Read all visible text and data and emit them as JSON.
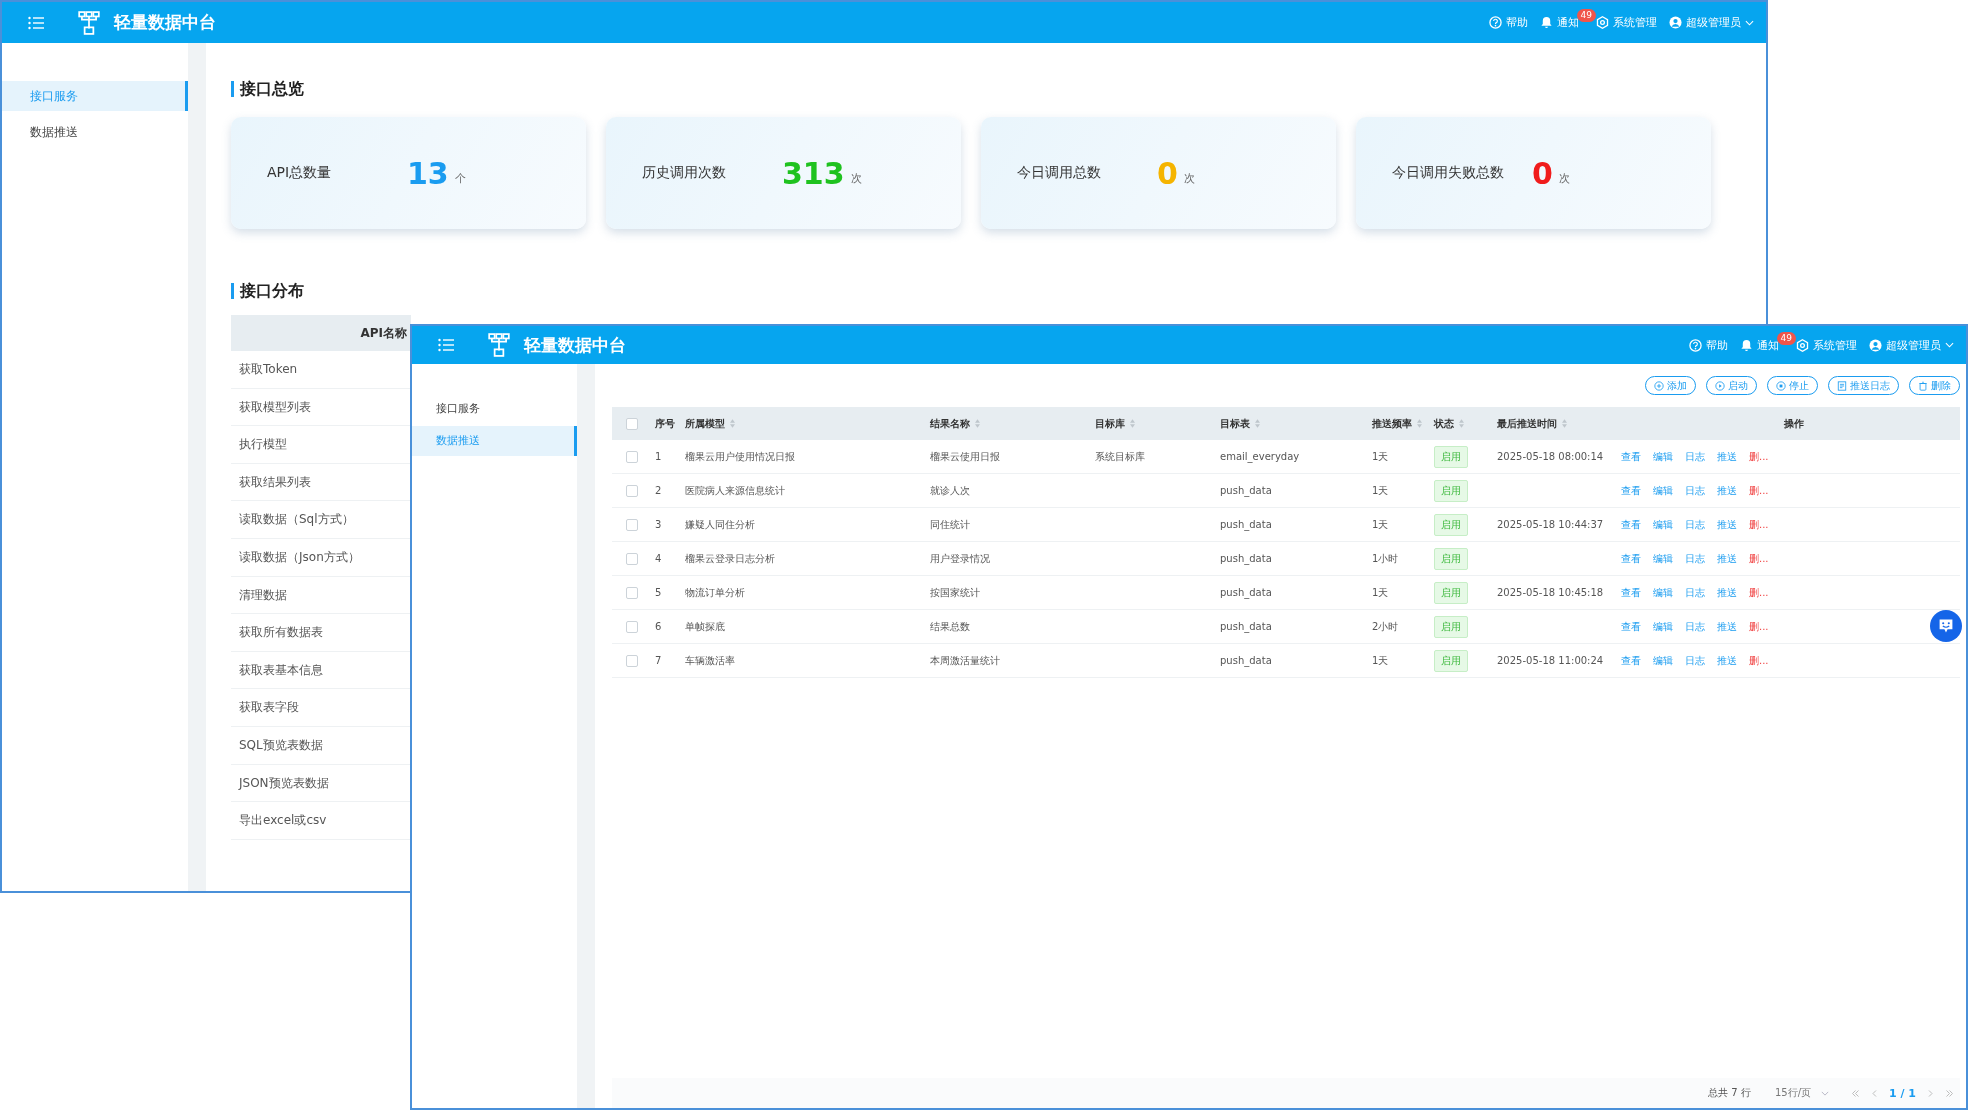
{
  "back_window": {
    "app_title": "轻量数据中台",
    "header_links": [
      {
        "kind": "help",
        "label": "帮助"
      },
      {
        "kind": "notice",
        "label": "通知",
        "badge": "49"
      },
      {
        "kind": "settings",
        "label": "系统管理"
      },
      {
        "kind": "user",
        "label": "超级管理员"
      }
    ],
    "nav": [
      {
        "label": "接口服务",
        "selected": true
      },
      {
        "label": "数据推送",
        "selected": false
      }
    ],
    "overview_title": "接口总览",
    "stats": [
      {
        "label": "API总数量",
        "value": "13",
        "unit": "个",
        "color": "#1a9cf0"
      },
      {
        "label": "历史调用次数",
        "value": "313",
        "unit": "次",
        "color": "#1fc21f"
      },
      {
        "label": "今日调用总数",
        "value": "0",
        "unit": "次",
        "color": "#f5b400"
      },
      {
        "label": "今日调用失败总数",
        "value": "0",
        "unit": "次",
        "color": "#f01c1c"
      }
    ],
    "distribution_title": "接口分布",
    "api_table": {
      "column": "API名称",
      "rows": [
        "获取Token",
        "获取模型列表",
        "执行模型",
        "获取结果列表",
        "读取数据（Sql方式）",
        "读取数据（Json方式）",
        "清理数据",
        "获取所有数据表",
        "获取表基本信息",
        "获取表字段",
        "SQL预览表数据",
        "JSON预览表数据",
        "导出excel或csv"
      ]
    }
  },
  "front_window": {
    "app_title": "轻量数据中台",
    "header_links": [
      {
        "kind": "help",
        "label": "帮助"
      },
      {
        "kind": "notice",
        "label": "通知",
        "badge": "49"
      },
      {
        "kind": "settings",
        "label": "系统管理"
      },
      {
        "kind": "user",
        "label": "超级管理员"
      }
    ],
    "nav": [
      {
        "label": "接口服务",
        "selected": false
      },
      {
        "label": "数据推送",
        "selected": true
      }
    ],
    "toolbar": [
      {
        "kind": "add",
        "label": "添加"
      },
      {
        "kind": "start",
        "label": "启动"
      },
      {
        "kind": "stop",
        "label": "停止"
      },
      {
        "kind": "log",
        "label": "推送日志"
      },
      {
        "kind": "delete",
        "label": "删除"
      }
    ],
    "all_checked": false,
    "columns": [
      {
        "label": "序号",
        "sortable": false
      },
      {
        "label": "所属模型",
        "sortable": true
      },
      {
        "label": "结果名称",
        "sortable": true
      },
      {
        "label": "目标库",
        "sortable": true
      },
      {
        "label": "目标表",
        "sortable": true
      },
      {
        "label": "推送频率",
        "sortable": true
      },
      {
        "label": "状态",
        "sortable": true
      },
      {
        "label": "最后推送时间",
        "sortable": true
      },
      {
        "label": "操作",
        "sortable": false
      }
    ],
    "rows": [
      {
        "checked": false,
        "no": "1",
        "model": "榴果云用户使用情况日报",
        "result": "榴果云使用日报",
        "db": "系统目标库",
        "table": "email_everyday",
        "freq": "1天",
        "status": "启用",
        "time": "2025-05-18 08:00:14",
        "actions": [
          {
            "kind": "normal",
            "label": "查看"
          },
          {
            "kind": "normal",
            "label": "编辑"
          },
          {
            "kind": "normal",
            "label": "日志"
          },
          {
            "kind": "normal",
            "label": "推送"
          },
          {
            "kind": "danger",
            "label": "删..."
          }
        ]
      },
      {
        "checked": false,
        "no": "2",
        "model": "医院病人来源信息统计",
        "result": "就诊人次",
        "db": "",
        "table": "push_data",
        "freq": "1天",
        "status": "启用",
        "time": "",
        "actions": [
          {
            "kind": "normal",
            "label": "查看"
          },
          {
            "kind": "normal",
            "label": "编辑"
          },
          {
            "kind": "normal",
            "label": "日志"
          },
          {
            "kind": "normal",
            "label": "推送"
          },
          {
            "kind": "danger",
            "label": "删..."
          }
        ]
      },
      {
        "checked": false,
        "no": "3",
        "model": "嫌疑人同住分析",
        "result": "同住统计",
        "db": "",
        "table": "push_data",
        "freq": "1天",
        "status": "启用",
        "time": "2025-05-18 10:44:37",
        "actions": [
          {
            "kind": "normal",
            "label": "查看"
          },
          {
            "kind": "normal",
            "label": "编辑"
          },
          {
            "kind": "normal",
            "label": "日志"
          },
          {
            "kind": "normal",
            "label": "推送"
          },
          {
            "kind": "danger",
            "label": "删..."
          }
        ]
      },
      {
        "checked": false,
        "no": "4",
        "model": "榴果云登录日志分析",
        "result": "用户登录情况",
        "db": "",
        "table": "push_data",
        "freq": "1小时",
        "status": "启用",
        "time": "",
        "actions": [
          {
            "kind": "normal",
            "label": "查看"
          },
          {
            "kind": "normal",
            "label": "编辑"
          },
          {
            "kind": "normal",
            "label": "日志"
          },
          {
            "kind": "normal",
            "label": "推送"
          },
          {
            "kind": "danger",
            "label": "删..."
          }
        ]
      },
      {
        "checked": false,
        "no": "5",
        "model": "物流订单分析",
        "result": "按国家统计",
        "db": "",
        "table": "push_data",
        "freq": "1天",
        "status": "启用",
        "time": "2025-05-18 10:45:18",
        "actions": [
          {
            "kind": "normal",
            "label": "查看"
          },
          {
            "kind": "normal",
            "label": "编辑"
          },
          {
            "kind": "normal",
            "label": "日志"
          },
          {
            "kind": "normal",
            "label": "推送"
          },
          {
            "kind": "danger",
            "label": "删..."
          }
        ]
      },
      {
        "checked": false,
        "no": "6",
        "model": "单帧探底",
        "result": "结果总数",
        "db": "",
        "table": "push_data",
        "freq": "2小时",
        "status": "启用",
        "time": "",
        "actions": [
          {
            "kind": "normal",
            "label": "查看"
          },
          {
            "kind": "normal",
            "label": "编辑"
          },
          {
            "kind": "normal",
            "label": "日志"
          },
          {
            "kind": "normal",
            "label": "推送"
          },
          {
            "kind": "danger",
            "label": "删..."
          }
        ]
      },
      {
        "checked": false,
        "no": "7",
        "model": "车辆激活率",
        "result": "本周激活量统计",
        "db": "",
        "table": "push_data",
        "freq": "1天",
        "status": "启用",
        "time": "2025-05-18 11:00:24",
        "actions": [
          {
            "kind": "normal",
            "label": "查看"
          },
          {
            "kind": "normal",
            "label": "编辑"
          },
          {
            "kind": "normal",
            "label": "日志"
          },
          {
            "kind": "normal",
            "label": "推送"
          },
          {
            "kind": "danger",
            "label": "删..."
          }
        ]
      }
    ],
    "pagination": {
      "total": "总共 7 行",
      "page_size": "15行/页",
      "page": "1 / 1"
    }
  }
}
